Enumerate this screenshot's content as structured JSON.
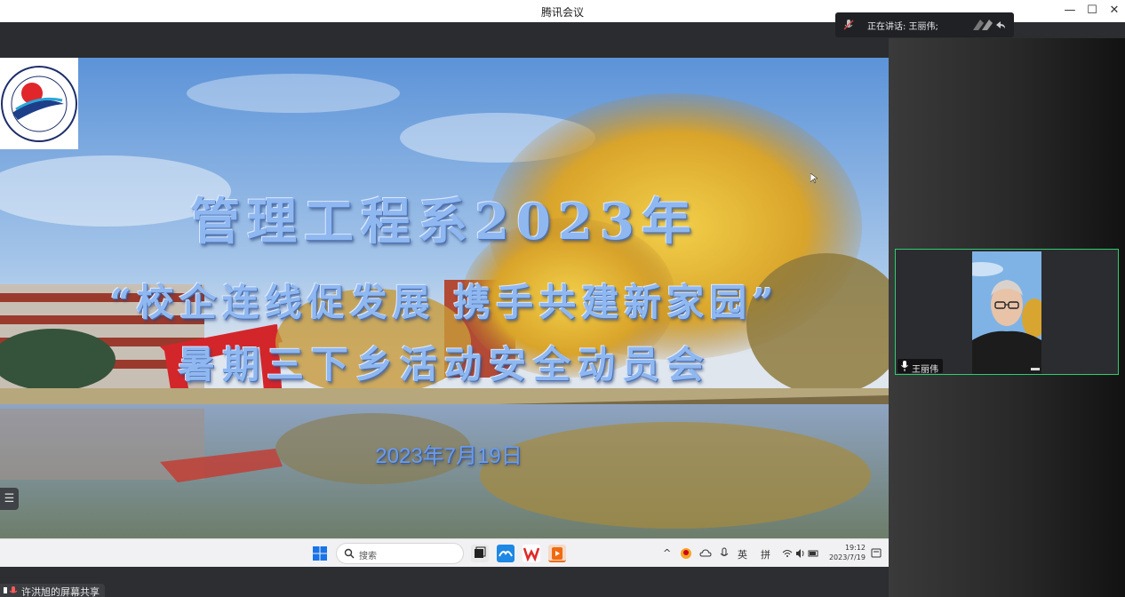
{
  "window": {
    "title": "腾讯会议",
    "minimize": "—",
    "maximize": "☐",
    "close": "✕"
  },
  "speaker_bar": {
    "label": "正在讲话: 王丽伟;"
  },
  "slide": {
    "title_line1": "管理工程系2023年",
    "title_line2": "“校企连线促发展 携手共建新家园”",
    "title_line3": "暑期三下乡活动安全动员会",
    "date": "2023年7月19日",
    "logo_text": "INSTITUTE OF ENGINEERING",
    "logo_chars": "东南工程学院"
  },
  "list_toggle": {
    "icon": "☰"
  },
  "taskbar": {
    "search_placeholder": "搜索",
    "tray_ime_lang": "英",
    "tray_ime_mode": "拼",
    "tray_chevron": "^",
    "clock_time": "19:12",
    "clock_date": "2023/7/19"
  },
  "share_status": {
    "label": "许洪旭的屏幕共享"
  },
  "participant": {
    "name": "王丽伟"
  },
  "colors": {
    "accent_green": "#2ecc71",
    "title_blue": "#8fb7f0",
    "dark_bg": "#2c2e31"
  },
  "icons": [
    "windows-start-icon",
    "search-icon",
    "app-icon",
    "wps-icon",
    "tray-icons",
    "mic-icon",
    "notification-icon"
  ]
}
